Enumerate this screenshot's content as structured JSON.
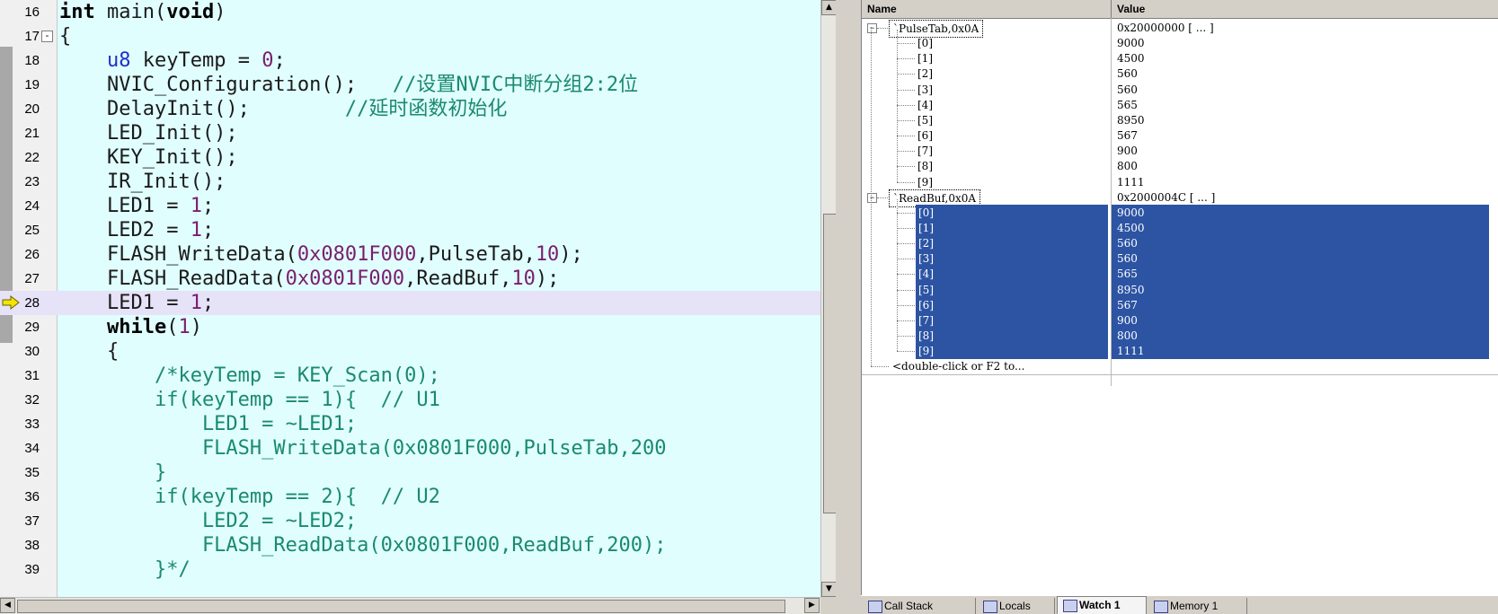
{
  "editor": {
    "lines": [
      {
        "num": "16",
        "segs": [
          {
            "t": "int",
            "c": "kw"
          },
          {
            "t": " main(",
            "c": ""
          },
          {
            "t": "void",
            "c": "kw"
          },
          {
            "t": ")",
            "c": ""
          }
        ]
      },
      {
        "num": "17",
        "fold": "-",
        "segs": [
          {
            "t": "{",
            "c": ""
          }
        ]
      },
      {
        "num": "18",
        "segs": [
          {
            "t": "    ",
            "c": ""
          },
          {
            "t": "u8",
            "c": "typ"
          },
          {
            "t": " keyTemp = ",
            "c": ""
          },
          {
            "t": "0",
            "c": "num"
          },
          {
            "t": ";",
            "c": ""
          }
        ]
      },
      {
        "num": "19",
        "segs": [
          {
            "t": "    NVIC_Configuration();   ",
            "c": ""
          },
          {
            "t": "//设置NVIC中断分组2:2位",
            "c": "cmt"
          }
        ]
      },
      {
        "num": "20",
        "segs": [
          {
            "t": "    DelayInit();        ",
            "c": ""
          },
          {
            "t": "//延时函数初始化",
            "c": "cmt"
          }
        ]
      },
      {
        "num": "21",
        "segs": [
          {
            "t": "    LED_Init();",
            "c": ""
          }
        ]
      },
      {
        "num": "22",
        "segs": [
          {
            "t": "    KEY_Init();",
            "c": ""
          }
        ]
      },
      {
        "num": "23",
        "segs": [
          {
            "t": "    IR_Init();",
            "c": ""
          }
        ]
      },
      {
        "num": "24",
        "segs": [
          {
            "t": "    LED1 = ",
            "c": ""
          },
          {
            "t": "1",
            "c": "num"
          },
          {
            "t": ";",
            "c": ""
          }
        ]
      },
      {
        "num": "25",
        "segs": [
          {
            "t": "    LED2 = ",
            "c": ""
          },
          {
            "t": "1",
            "c": "num"
          },
          {
            "t": ";",
            "c": ""
          }
        ]
      },
      {
        "num": "26",
        "segs": [
          {
            "t": "    FLASH_WriteData(",
            "c": ""
          },
          {
            "t": "0x0801F000",
            "c": "num"
          },
          {
            "t": ",PulseTab,",
            "c": ""
          },
          {
            "t": "10",
            "c": "num"
          },
          {
            "t": ");",
            "c": ""
          }
        ]
      },
      {
        "num": "27",
        "segs": [
          {
            "t": "    FLASH_ReadData(",
            "c": ""
          },
          {
            "t": "0x0801F000",
            "c": "num"
          },
          {
            "t": ",ReadBuf,",
            "c": ""
          },
          {
            "t": "10",
            "c": "num"
          },
          {
            "t": ");",
            "c": ""
          }
        ]
      },
      {
        "num": "28",
        "current": true,
        "segs": [
          {
            "t": "    LED1 = ",
            "c": ""
          },
          {
            "t": "1",
            "c": "num"
          },
          {
            "t": ";",
            "c": ""
          }
        ]
      },
      {
        "num": "29",
        "segs": [
          {
            "t": "    ",
            "c": ""
          },
          {
            "t": "while",
            "c": "kw"
          },
          {
            "t": "(",
            "c": ""
          },
          {
            "t": "1",
            "c": "num"
          },
          {
            "t": ")",
            "c": ""
          }
        ]
      },
      {
        "num": "30",
        "segs": [
          {
            "t": "    {",
            "c": ""
          }
        ]
      },
      {
        "num": "31",
        "segs": [
          {
            "t": "        /*keyTemp = KEY_Scan(0);",
            "c": "cmt"
          }
        ]
      },
      {
        "num": "32",
        "segs": [
          {
            "t": "        if(keyTemp == 1){  // U1",
            "c": "cmt"
          }
        ]
      },
      {
        "num": "33",
        "segs": [
          {
            "t": "            LED1 = ~LED1;",
            "c": "cmt"
          }
        ]
      },
      {
        "num": "34",
        "segs": [
          {
            "t": "            FLASH_WriteData(0x0801F000,PulseTab,200",
            "c": "cmt"
          }
        ]
      },
      {
        "num": "35",
        "segs": [
          {
            "t": "        }",
            "c": "cmt"
          }
        ]
      },
      {
        "num": "36",
        "segs": [
          {
            "t": "        if(keyTemp == 2){  // U2",
            "c": "cmt"
          }
        ]
      },
      {
        "num": "37",
        "segs": [
          {
            "t": "            LED2 = ~LED2;",
            "c": "cmt"
          }
        ]
      },
      {
        "num": "38",
        "segs": [
          {
            "t": "            FLASH_ReadData(0x0801F000,ReadBuf,200);",
            "c": "cmt"
          }
        ]
      },
      {
        "num": "39",
        "segs": [
          {
            "t": "        }*/",
            "c": "cmt"
          }
        ]
      }
    ]
  },
  "watch": {
    "headers": {
      "name": "Name",
      "value": "Value"
    },
    "groups": [
      {
        "label": "`PulseTab,0x0A",
        "value": "0x20000000 [ ... ]",
        "items": [
          {
            "name": "[0]",
            "value": "9000"
          },
          {
            "name": "[1]",
            "value": "4500"
          },
          {
            "name": "[2]",
            "value": "560"
          },
          {
            "name": "[3]",
            "value": "560"
          },
          {
            "name": "[4]",
            "value": "565"
          },
          {
            "name": "[5]",
            "value": "8950"
          },
          {
            "name": "[6]",
            "value": "567"
          },
          {
            "name": "[7]",
            "value": "900"
          },
          {
            "name": "[8]",
            "value": "800"
          },
          {
            "name": "[9]",
            "value": "1111"
          }
        ]
      },
      {
        "label": "`ReadBuf,0x0A",
        "value": "0x2000004C [ ... ]",
        "selected": true,
        "items": [
          {
            "name": "[0]",
            "value": "9000"
          },
          {
            "name": "[1]",
            "value": "4500"
          },
          {
            "name": "[2]",
            "value": "560"
          },
          {
            "name": "[3]",
            "value": "560"
          },
          {
            "name": "[4]",
            "value": "565"
          },
          {
            "name": "[5]",
            "value": "8950"
          },
          {
            "name": "[6]",
            "value": "567"
          },
          {
            "name": "[7]",
            "value": "900"
          },
          {
            "name": "[8]",
            "value": "800"
          },
          {
            "name": "[9]",
            "value": "1111"
          }
        ]
      }
    ],
    "add_hint": "<double-click or F2 to..."
  },
  "tabs": [
    {
      "label": "Call Stack",
      "icon": "call-stack-icon"
    },
    {
      "label": "Locals",
      "icon": "locals-icon"
    },
    {
      "label": "Watch 1",
      "icon": "watch-icon",
      "active": true
    },
    {
      "label": "Memory 1",
      "icon": "memory-icon"
    }
  ],
  "colors": {
    "editor_bg": "#e0fefe",
    "current_line": "#e6e2f8",
    "selection": "#2d54a3",
    "comment": "#1a8a6c",
    "number": "#7a1e6c"
  }
}
